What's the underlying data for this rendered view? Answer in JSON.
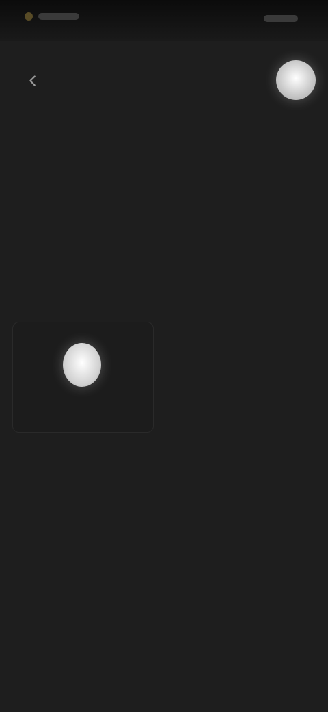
{
  "status_bar": {
    "time": "",
    "indicators": ""
  },
  "header": {
    "back_icon": "arrow-left-icon",
    "avatar_icon": "avatar-circle"
  },
  "main": {
    "title": "",
    "link_text": "",
    "line1": "",
    "line2": ""
  },
  "card": {
    "caption": "",
    "title": "",
    "icon": "file-icon"
  },
  "colors": {
    "background": "#1e1e1e",
    "link": "#2a6f95",
    "text_primary": "#d9d9d9",
    "text_secondary": "#8f8f8f"
  }
}
